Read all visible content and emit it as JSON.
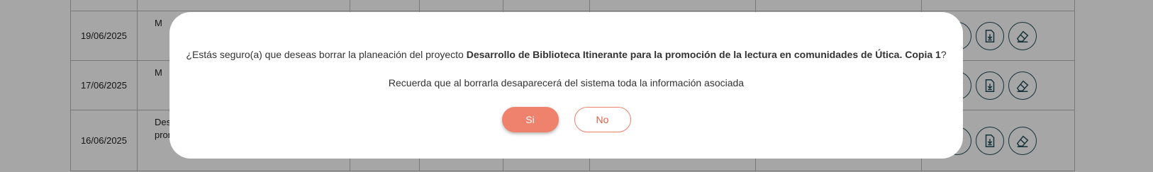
{
  "table": {
    "rows": [
      {
        "date": "",
        "title": ""
      },
      {
        "date": "19/06/2025",
        "title": "M"
      },
      {
        "date": "17/06/2025",
        "title": "M"
      },
      {
        "date": "16/06/2025",
        "title_line1": "Desa",
        "title_line2": "pron"
      }
    ]
  },
  "icons": {
    "edit": "pencil-icon",
    "download": "download-icon",
    "erase": "eraser-icon"
  },
  "dialog": {
    "message_prefix": "¿Estás seguro(a) que deseas borrar la planeación del proyecto ",
    "project_name": "Desarrollo de Biblioteca Itinerante para la promoción de la lectura en comunidades de Útica. Copia 1",
    "message_suffix": "?",
    "warning": "Recuerda que al borrarla desaparecerá del sistema toda la información asociada",
    "yes_label": "Si",
    "no_label": "No"
  },
  "colors": {
    "accent": "#ee826c",
    "icon_stroke": "#1f4e5a",
    "overlay": "rgba(0,0,0,0.35)"
  }
}
